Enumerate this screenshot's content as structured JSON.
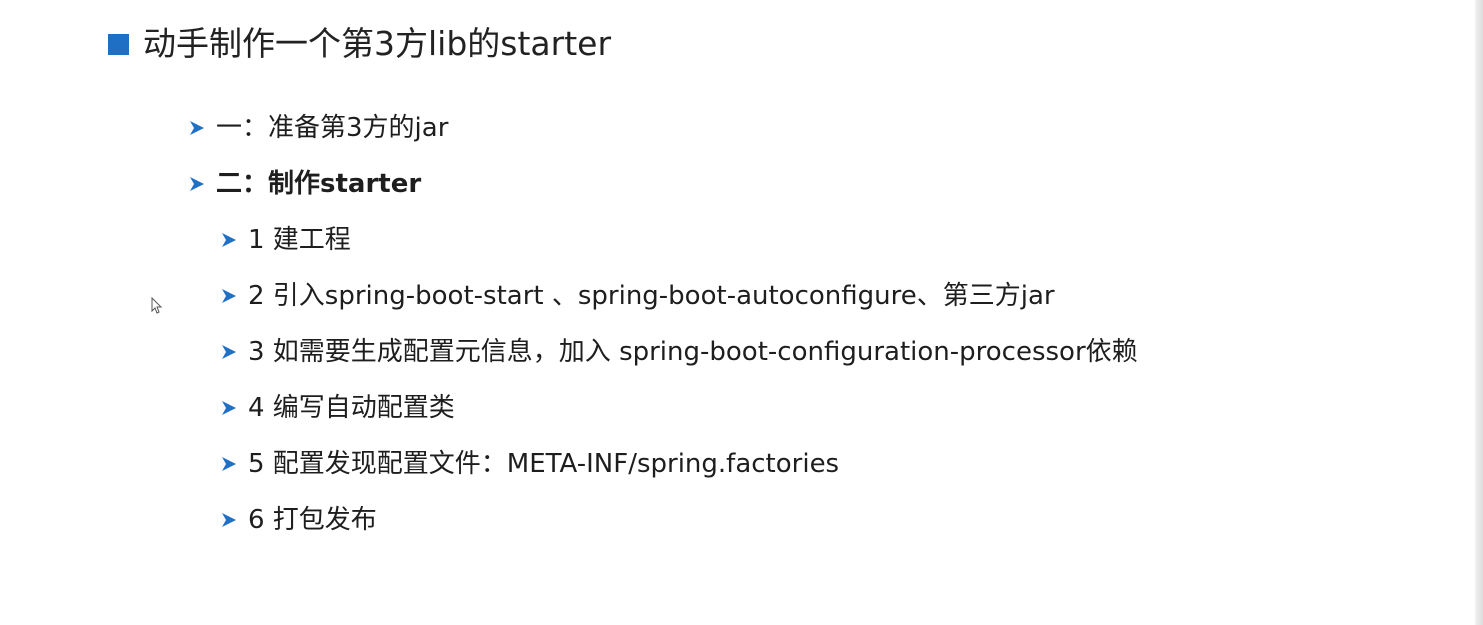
{
  "title": "动手制作一个第3方lib的starter",
  "accent_color": "#1f6fc5",
  "arrow_icon": "chevron-arrow-icon",
  "items": [
    {
      "text": "一：准备第3方的jar",
      "bold": false
    },
    {
      "text": "二：制作starter",
      "bold": true
    },
    {
      "text": "1 建工程",
      "bold": false
    },
    {
      "text": "2 引入spring-boot-start 、spring-boot-autoconfigure、第三方jar",
      "bold": false
    },
    {
      "text": "3 如需要生成配置元信息，加入 spring-boot-configuration-processor依赖",
      "bold": false
    },
    {
      "text": "4 编写自动配置类",
      "bold": false
    },
    {
      "text": "5 配置发现配置文件：META-INF/spring.factories",
      "bold": false
    },
    {
      "text": "6 打包发布",
      "bold": false
    }
  ]
}
